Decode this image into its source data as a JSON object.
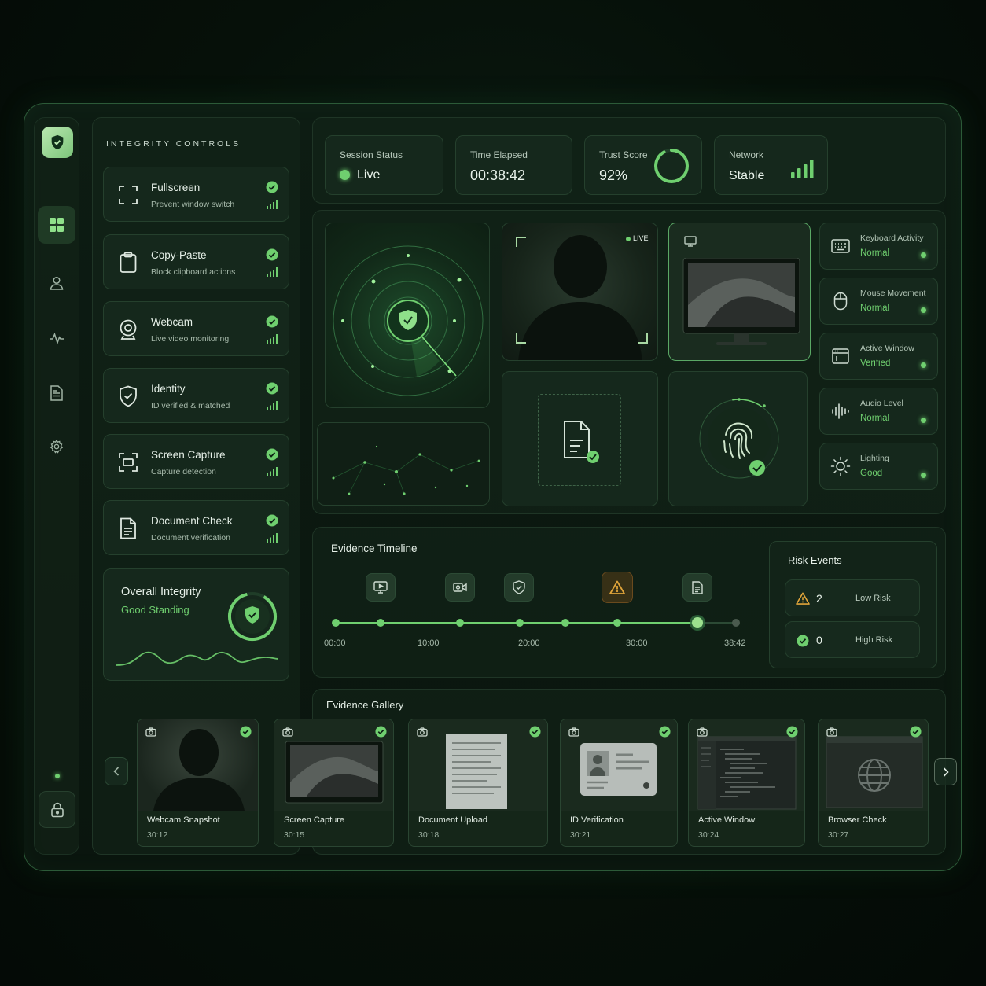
{
  "controls": {
    "title": "INTEGRITY CONTROLS",
    "items": [
      {
        "name": "Fullscreen",
        "desc": "Prevent window switch",
        "icon": "fullscreen-icon"
      },
      {
        "name": "Copy-Paste",
        "desc": "Block clipboard actions",
        "icon": "clipboard-icon"
      },
      {
        "name": "Webcam",
        "desc": "Live video monitoring",
        "icon": "webcam-icon"
      },
      {
        "name": "Identity",
        "desc": "ID verified & matched",
        "icon": "shield-icon"
      },
      {
        "name": "Screen Capture",
        "desc": "Capture detection",
        "icon": "screen-capture-icon"
      },
      {
        "name": "Document Check",
        "desc": "Document verification",
        "icon": "document-icon"
      }
    ]
  },
  "overall": {
    "title": "Overall Integrity",
    "status": "Good Standing"
  },
  "status": {
    "session": {
      "label": "Session Status",
      "value": "Live"
    },
    "time": {
      "label": "Time Elapsed",
      "value": "00:38:42"
    },
    "trust": {
      "label": "Trust Score",
      "value": "92%",
      "score": 0.92
    },
    "network": {
      "label": "Network",
      "value": "Stable"
    }
  },
  "webcam_feed": {
    "badge": "LIVE"
  },
  "monitors": [
    {
      "label": "Keyboard Activity",
      "value": "Normal",
      "icon": "keyboard-icon"
    },
    {
      "label": "Mouse Movement",
      "value": "Normal",
      "icon": "mouse-icon"
    },
    {
      "label": "Active Window",
      "value": "Verified",
      "icon": "window-icon"
    },
    {
      "label": "Audio Level",
      "value": "Normal",
      "icon": "audio-icon"
    },
    {
      "label": "Lighting",
      "value": "Good",
      "icon": "sun-icon"
    }
  ],
  "timeline": {
    "title": "Evidence Timeline",
    "ticks": [
      "00:00",
      "10:00",
      "20:00",
      "30:00",
      "38:42"
    ]
  },
  "risk": {
    "title": "Risk Events",
    "low": {
      "count": "2",
      "label": "Low Risk"
    },
    "high": {
      "count": "0",
      "label": "High Risk"
    }
  },
  "gallery": {
    "title": "Evidence Gallery",
    "items": [
      {
        "name": "Webcam Snapshot",
        "time": "30:12"
      },
      {
        "name": "Screen Capture",
        "time": "30:15"
      },
      {
        "name": "Document Upload",
        "time": "30:18"
      },
      {
        "name": "ID Verification",
        "time": "30:21"
      },
      {
        "name": "Active Window",
        "time": "30:24"
      },
      {
        "name": "Browser Check",
        "time": "30:27"
      }
    ]
  },
  "colors": {
    "accent": "#6fcf6f",
    "warning": "#e0a43a",
    "background": "#061009"
  }
}
